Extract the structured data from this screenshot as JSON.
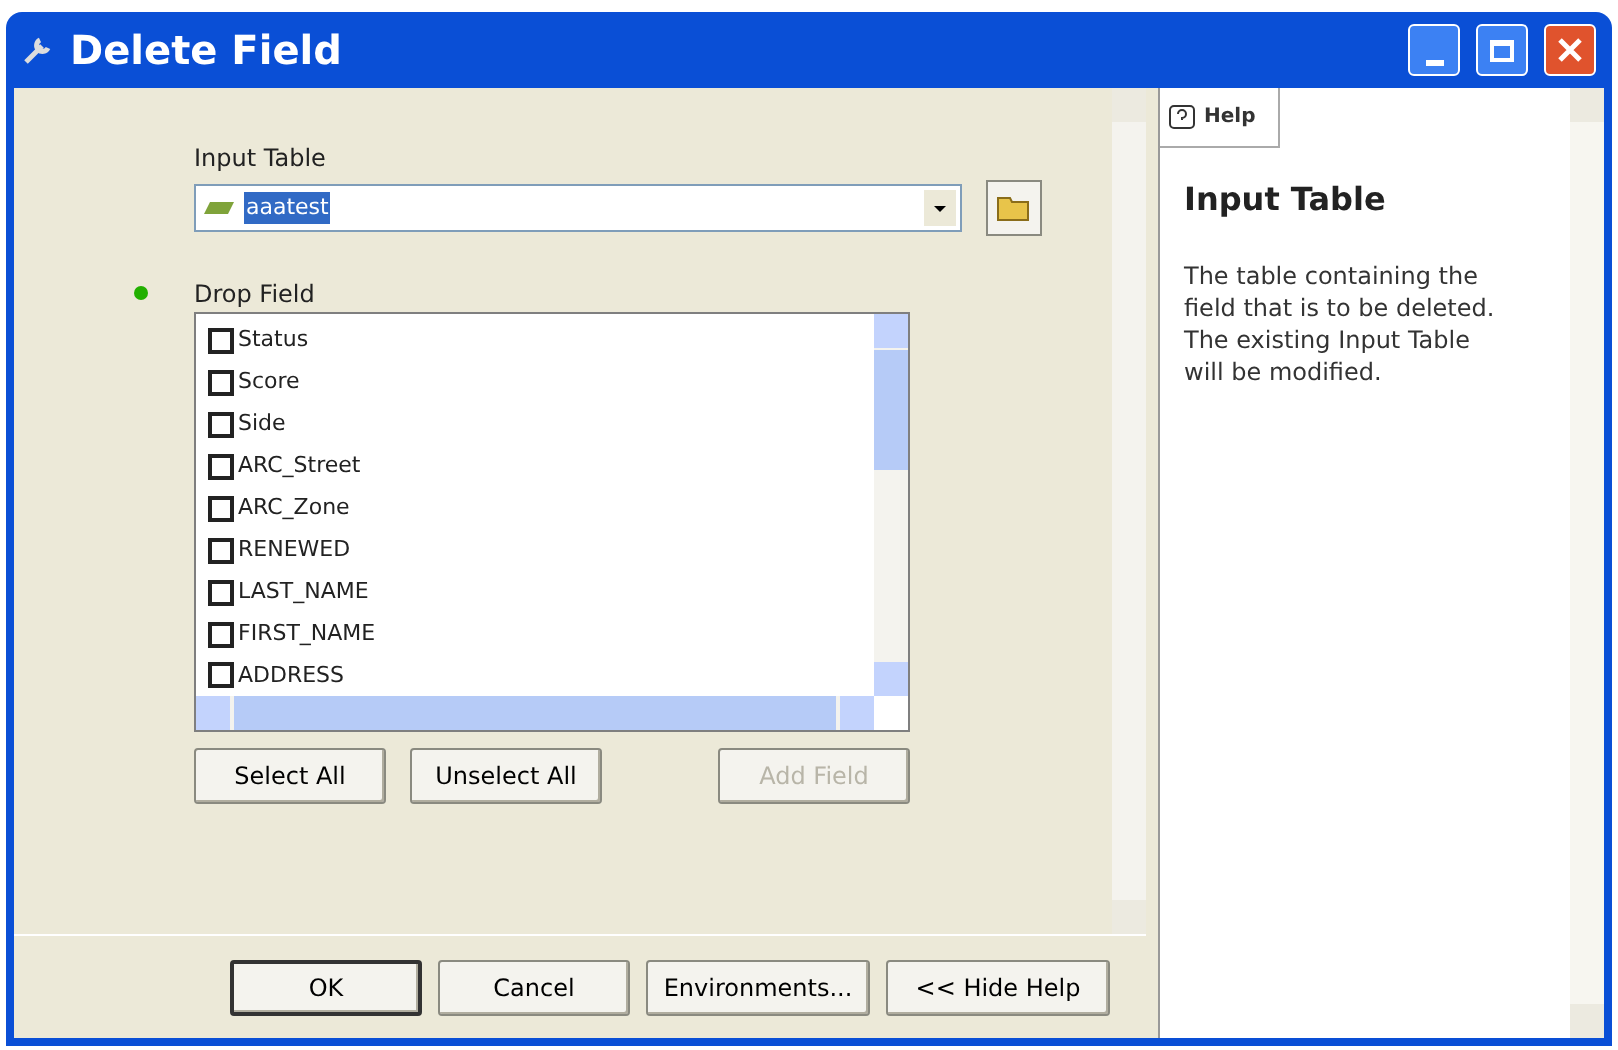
{
  "window": {
    "title": "Delete Field"
  },
  "input_table": {
    "label": "Input Table",
    "value": "aaatest"
  },
  "drop_field": {
    "label": "Drop Field",
    "required": true,
    "items": [
      {
        "label": "Status",
        "checked": false
      },
      {
        "label": "Score",
        "checked": false
      },
      {
        "label": "Side",
        "checked": false
      },
      {
        "label": "ARC_Street",
        "checked": false
      },
      {
        "label": "ARC_Zone",
        "checked": false
      },
      {
        "label": "RENEWED",
        "checked": false
      },
      {
        "label": "LAST_NAME",
        "checked": false
      },
      {
        "label": "FIRST_NAME",
        "checked": false
      },
      {
        "label": "ADDRESS",
        "checked": false
      }
    ]
  },
  "list_buttons": [
    {
      "label": "Select All",
      "disabled": false
    },
    {
      "label": "Unselect All",
      "disabled": false
    },
    {
      "label": "Add Field",
      "disabled": true
    }
  ],
  "help": {
    "tab": "Help",
    "title": "Input Table",
    "text": "The table containing the field that is to be deleted. The existing Input Table will be modified."
  },
  "buttons": [
    {
      "label": "OK",
      "default": true
    },
    {
      "label": "Cancel",
      "default": false
    },
    {
      "label": "Environments...",
      "default": false
    },
    {
      "label": "<< Hide Help",
      "default": false
    }
  ]
}
